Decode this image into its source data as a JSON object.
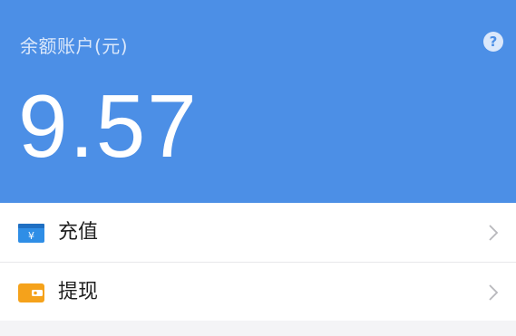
{
  "account": {
    "label": "余额账户(元)",
    "balance": "9.57",
    "help_icon": "?"
  },
  "menu": {
    "items": [
      {
        "label": "充值",
        "icon": "recharge-icon",
        "icon_color": "#2f8ee6"
      },
      {
        "label": "提现",
        "icon": "withdraw-icon",
        "icon_color": "#f5a21b"
      }
    ]
  },
  "colors": {
    "header_bg": "#4c8fe6",
    "page_bg": "#f4f4f6"
  }
}
